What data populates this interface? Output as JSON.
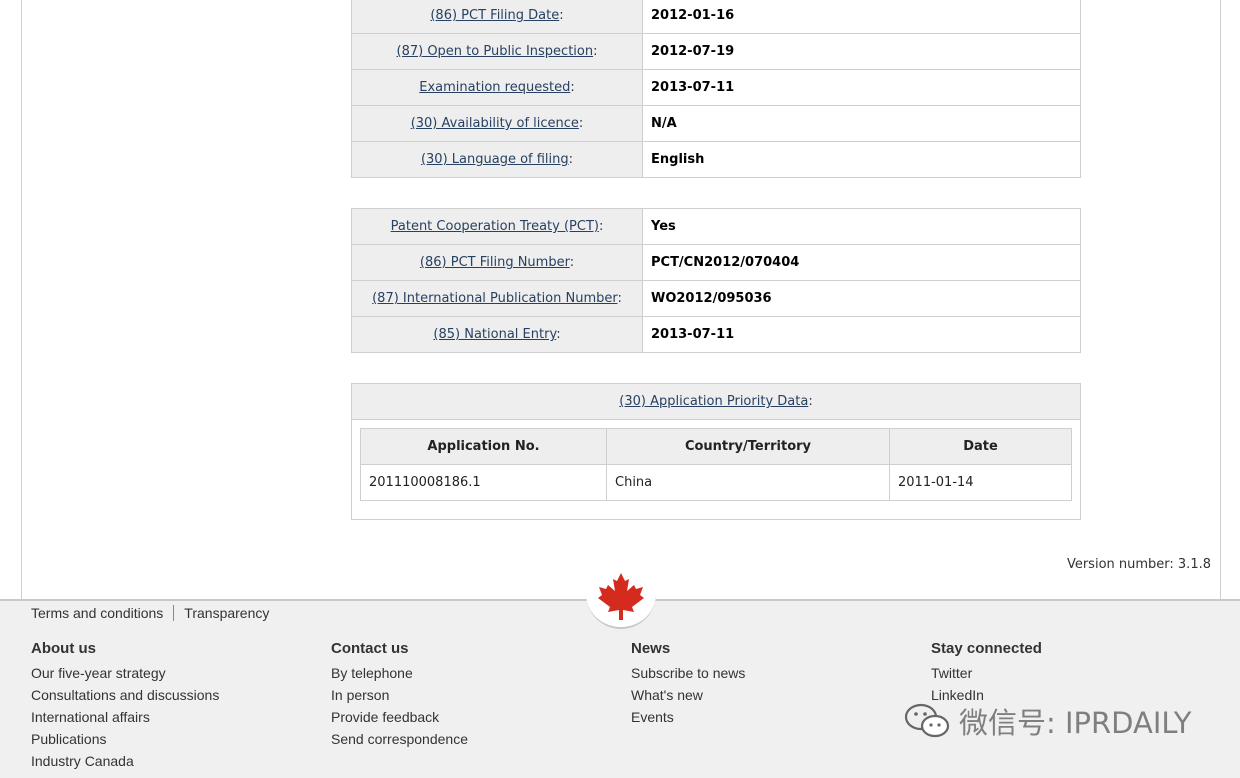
{
  "table1": [
    {
      "label_link": "(86) PCT Filing Date",
      "value": "2012-01-16"
    },
    {
      "label_link": "(87) Open to Public Inspection",
      "value": "2012-07-19"
    },
    {
      "label_link": "Examination requested",
      "value": "2013-07-11"
    },
    {
      "label_link": "(30) Availability of licence",
      "value": "N/A"
    },
    {
      "label_link": "(30) Language of filing",
      "value": "English"
    }
  ],
  "table2": [
    {
      "label_link": "Patent Cooperation Treaty (PCT)",
      "value": "Yes"
    },
    {
      "label_link": "(86) PCT Filing Number",
      "value": "PCT/CN2012/070404"
    },
    {
      "label_link": "(87) International Publication Number",
      "value": "WO2012/095036"
    },
    {
      "label_link": "(85) National Entry",
      "value": "2013-07-11"
    }
  ],
  "priority": {
    "heading_link": "(30) Application Priority Data",
    "columns": [
      "Application No.",
      "Country/Territory",
      "Date"
    ],
    "rows": [
      [
        "201110008186.1",
        "China",
        "2011-01-14"
      ]
    ]
  },
  "version": "Version number: 3.1.8",
  "footer": {
    "terms": [
      "Terms and conditions",
      "Transparency"
    ],
    "columns": [
      {
        "title": "About us",
        "links": [
          "Our five-year strategy",
          "Consultations and discussions",
          "International affairs",
          "Publications",
          "Industry Canada"
        ]
      },
      {
        "title": "Contact us",
        "links": [
          "By telephone",
          "In person",
          "Provide feedback",
          "Send correspondence"
        ]
      },
      {
        "title": "News",
        "links": [
          "Subscribe to news",
          "What's new",
          "Events"
        ]
      },
      {
        "title": "Stay connected",
        "links": [
          "Twitter",
          "LinkedIn"
        ]
      }
    ]
  },
  "watermark": "微信号: IPRDAILY",
  "colors": {
    "link": "#284162",
    "label_bg": "#eeeeee",
    "footer_bg": "#f0f0f0",
    "maple": "#d52b1e"
  }
}
